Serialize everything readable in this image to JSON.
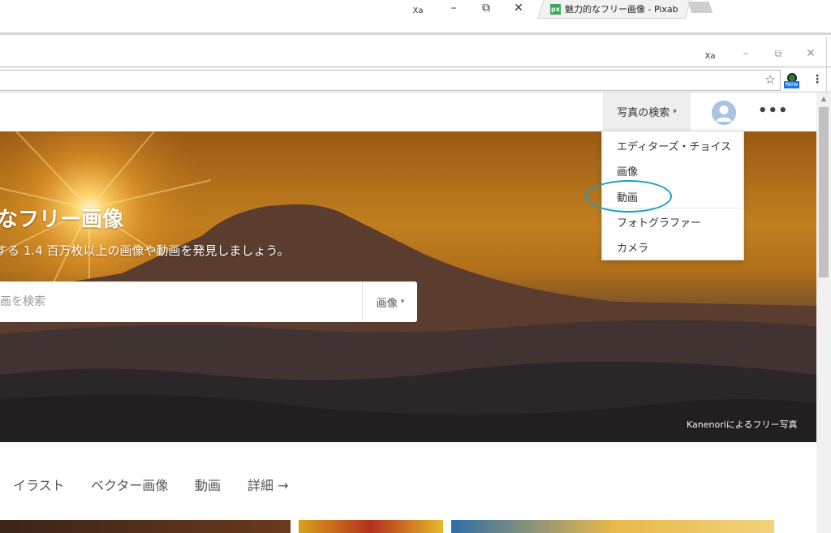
{
  "outer_window": {
    "tab_title": "魅力的なフリー画像 - Pixab",
    "tab_favicon": "px",
    "controls": {
      "translate": "Xa",
      "minimize": "–",
      "restore": "⧉",
      "close": "✕"
    },
    "tab_close": "✕"
  },
  "inner_window": {
    "controls": {
      "translate": "Xa",
      "minimize": "–",
      "restore": "⧉",
      "close": "✕"
    },
    "star_icon": "☆",
    "extension_badge": "New",
    "menu_icon": "⋮"
  },
  "header": {
    "explore_label": "写真の検索",
    "caret": "▾",
    "more": "•••"
  },
  "dropdown": {
    "items": [
      "エディターズ・チョイス",
      "画像",
      "動画",
      "フォトグラファー",
      "カメラ"
    ]
  },
  "hero": {
    "title": "なフリー画像",
    "subtitle": "する 1.4 百万枚以上の画像や動画を発見しましょう。",
    "search_placeholder": "画を検索",
    "search_type": "画像",
    "credit": "Kanenoriによるフリー写真"
  },
  "categories": [
    "イラスト",
    "ベクター画像",
    "動画",
    "詳細 →"
  ],
  "colors": {
    "annotation_circle": "#17a0c4",
    "hero_top": "#9a5a14",
    "hero_bottom": "#2f2a2b",
    "favicon": "#3aa75b"
  }
}
